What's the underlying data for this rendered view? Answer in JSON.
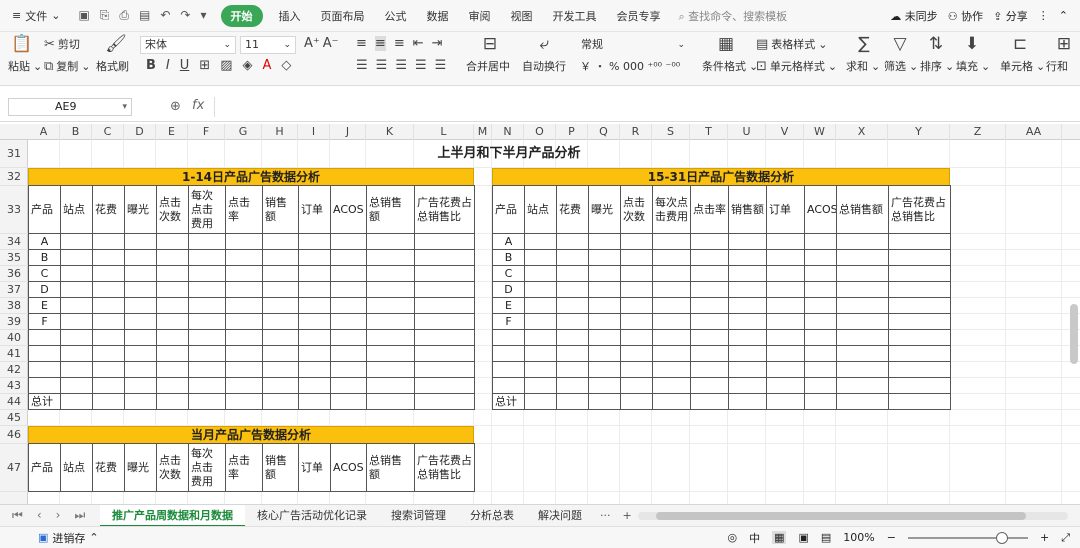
{
  "menubar": {
    "file": "文件",
    "start": "开始",
    "items": [
      "插入",
      "页面布局",
      "公式",
      "数据",
      "审阅",
      "视图",
      "开发工具",
      "会员专享"
    ],
    "search_placeholder": "查找命令、搜索模板",
    "unsynced": "未同步",
    "collab": "协作",
    "share": "分享"
  },
  "ribbon": {
    "paste": "粘贴",
    "cut": "剪切",
    "copy": "复制",
    "format_painter": "格式刷",
    "font_name": "宋体",
    "font_size": "11",
    "merge_center": "合并居中",
    "wrap_text": "自动换行",
    "number_format": "常规",
    "cond_format": "条件格式",
    "table_style": "表格样式",
    "cell_style": "单元格样式",
    "sum": "求和",
    "filter": "筛选",
    "sort": "排序",
    "fill": "填充",
    "cell": "单元格",
    "rowcol": "行和",
    "num_symbols": "￥ ・ %  000  ⁺⁰⁰  ⁻⁰⁰"
  },
  "formula": {
    "namebox": "AE9",
    "fx": "fx"
  },
  "columns": [
    "A",
    "B",
    "C",
    "D",
    "E",
    "F",
    "G",
    "H",
    "I",
    "J",
    "K",
    "L",
    "M",
    "N",
    "O",
    "P",
    "Q",
    "R",
    "S",
    "T",
    "U",
    "V",
    "W",
    "X",
    "Y",
    "Z",
    "AA"
  ],
  "rows": [
    "31",
    "32",
    "33",
    "34",
    "35",
    "36",
    "37",
    "38",
    "39",
    "40",
    "41",
    "42",
    "43",
    "44",
    "45",
    "46",
    "47"
  ],
  "sheet": {
    "title": "上半月和下半月产品分析",
    "banner_left": "1-14日产品广告数据分析",
    "banner_right": "15-31日产品广告数据分析",
    "banner_month": "当月产品广告数据分析",
    "headers": [
      "产品",
      "站点",
      "花费",
      "曝光",
      "点击次数",
      "每次点击费用",
      "点击率",
      "销售额",
      "订单",
      "ACOS",
      "总销售额",
      "广告花费占总销售比"
    ],
    "products": [
      "A",
      "B",
      "C",
      "D",
      "E",
      "F"
    ],
    "total": "总计"
  },
  "tabs": {
    "sheets": [
      "推广产品周数据和月数据",
      "核心广告活动优化记录",
      "搜索词管理",
      "分析总表",
      "解决问题"
    ],
    "more": "···",
    "add": "+"
  },
  "status": {
    "macro": "进销存",
    "zoom": "100%"
  }
}
